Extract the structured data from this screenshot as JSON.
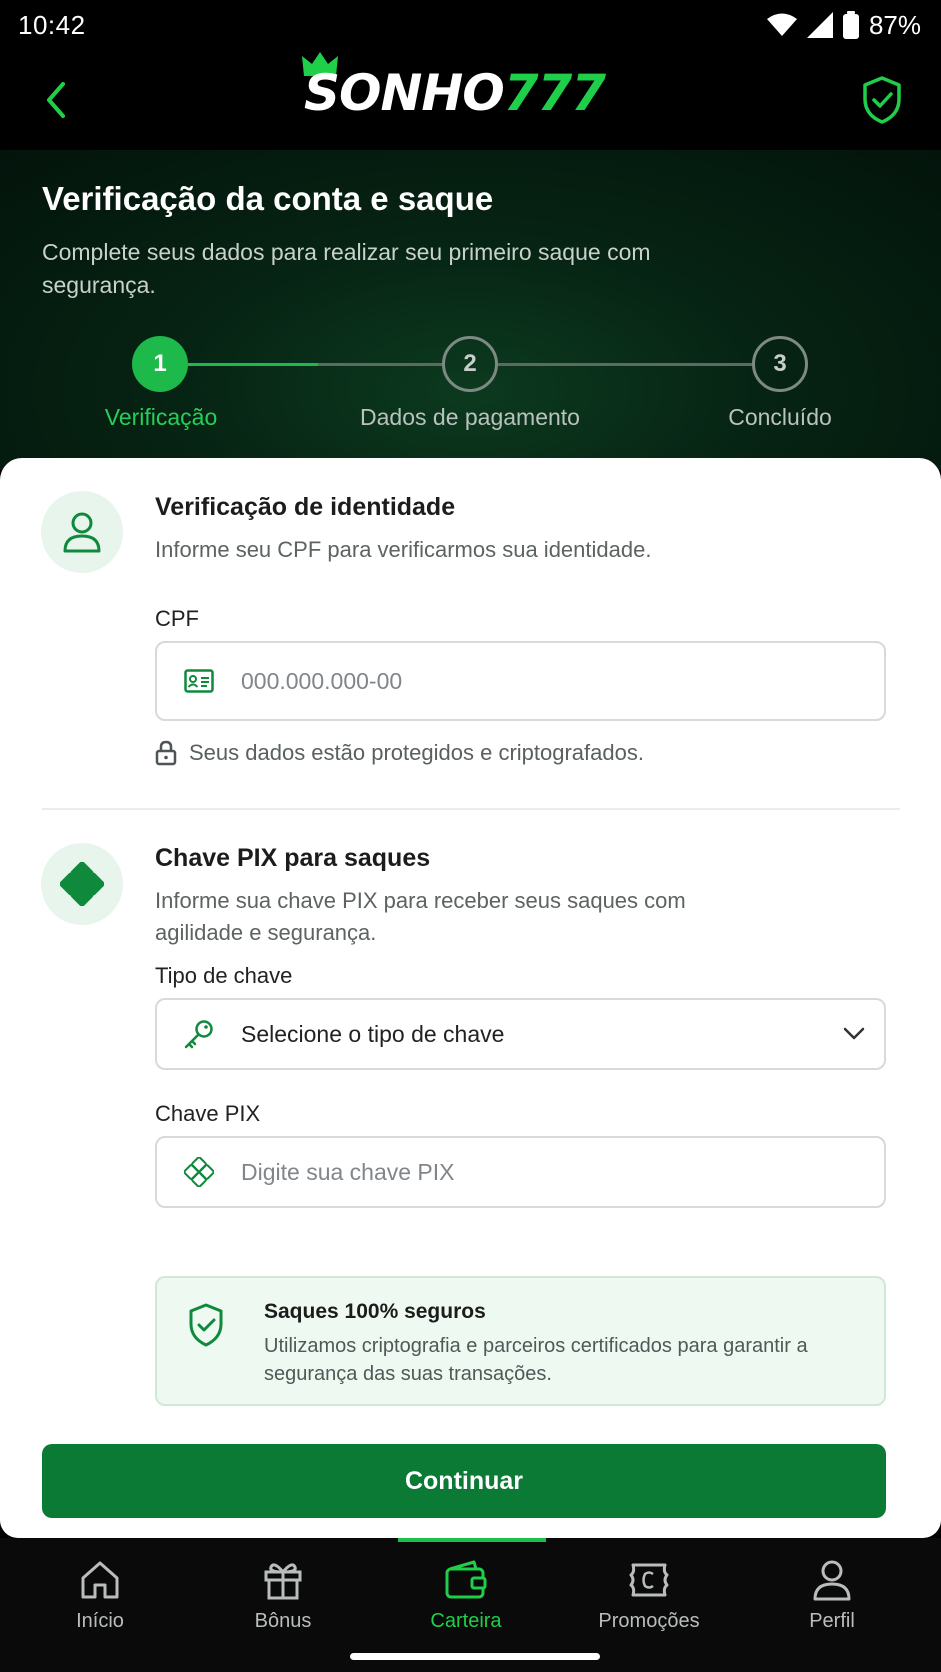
{
  "status_bar": {
    "time": "10:42",
    "battery": "87%"
  },
  "header": {
    "logo_main": "SONHO",
    "logo_accent": "777"
  },
  "hero": {
    "title": "Verificação da conta e saque",
    "subtitle": "Complete seus dados para realizar seu primeiro saque com segurança."
  },
  "stepper": {
    "steps": [
      {
        "number": "1",
        "label": "Verificação",
        "state": "active"
      },
      {
        "number": "2",
        "label": "Dados de pagamento",
        "state": "pending"
      },
      {
        "number": "3",
        "label": "Concluído",
        "state": "pending"
      }
    ]
  },
  "identity": {
    "title": "Verificação de identidade",
    "description": "Informe seu CPF para verificarmos sua identidade.",
    "cpf_label": "CPF",
    "cpf_placeholder": "000.000.000-00",
    "cpf_value": "",
    "secure_note": "Seus dados estão protegidos e criptografados."
  },
  "pix": {
    "title": "Chave PIX para saques",
    "description": "Informe sua chave PIX para receber seus saques com agilidade e segurança.",
    "key_type_label": "Tipo de chave",
    "key_type_value": "Selecione o tipo de chave",
    "key_label": "Chave PIX",
    "key_placeholder": "Digite sua chave PIX",
    "key_value": ""
  },
  "info_box": {
    "title": "Saques 100% seguros",
    "text": "Utilizamos criptografia e parceiros certificados para garantir a segurança das suas transações."
  },
  "continue_label": "Continuar",
  "bottom_nav": {
    "items": [
      {
        "label": "Início",
        "icon": "home-icon",
        "active": false
      },
      {
        "label": "Bônus",
        "icon": "gift-icon",
        "active": false
      },
      {
        "label": "Carteira",
        "icon": "wallet-icon",
        "active": true
      },
      {
        "label": "Promoções",
        "icon": "coupon-icon",
        "active": false
      },
      {
        "label": "Perfil",
        "icon": "person-icon",
        "active": false
      }
    ]
  },
  "colors": {
    "brand_green": "#1fcf4a",
    "button_green": "#0a7a35",
    "hero_bg": "#062313"
  }
}
